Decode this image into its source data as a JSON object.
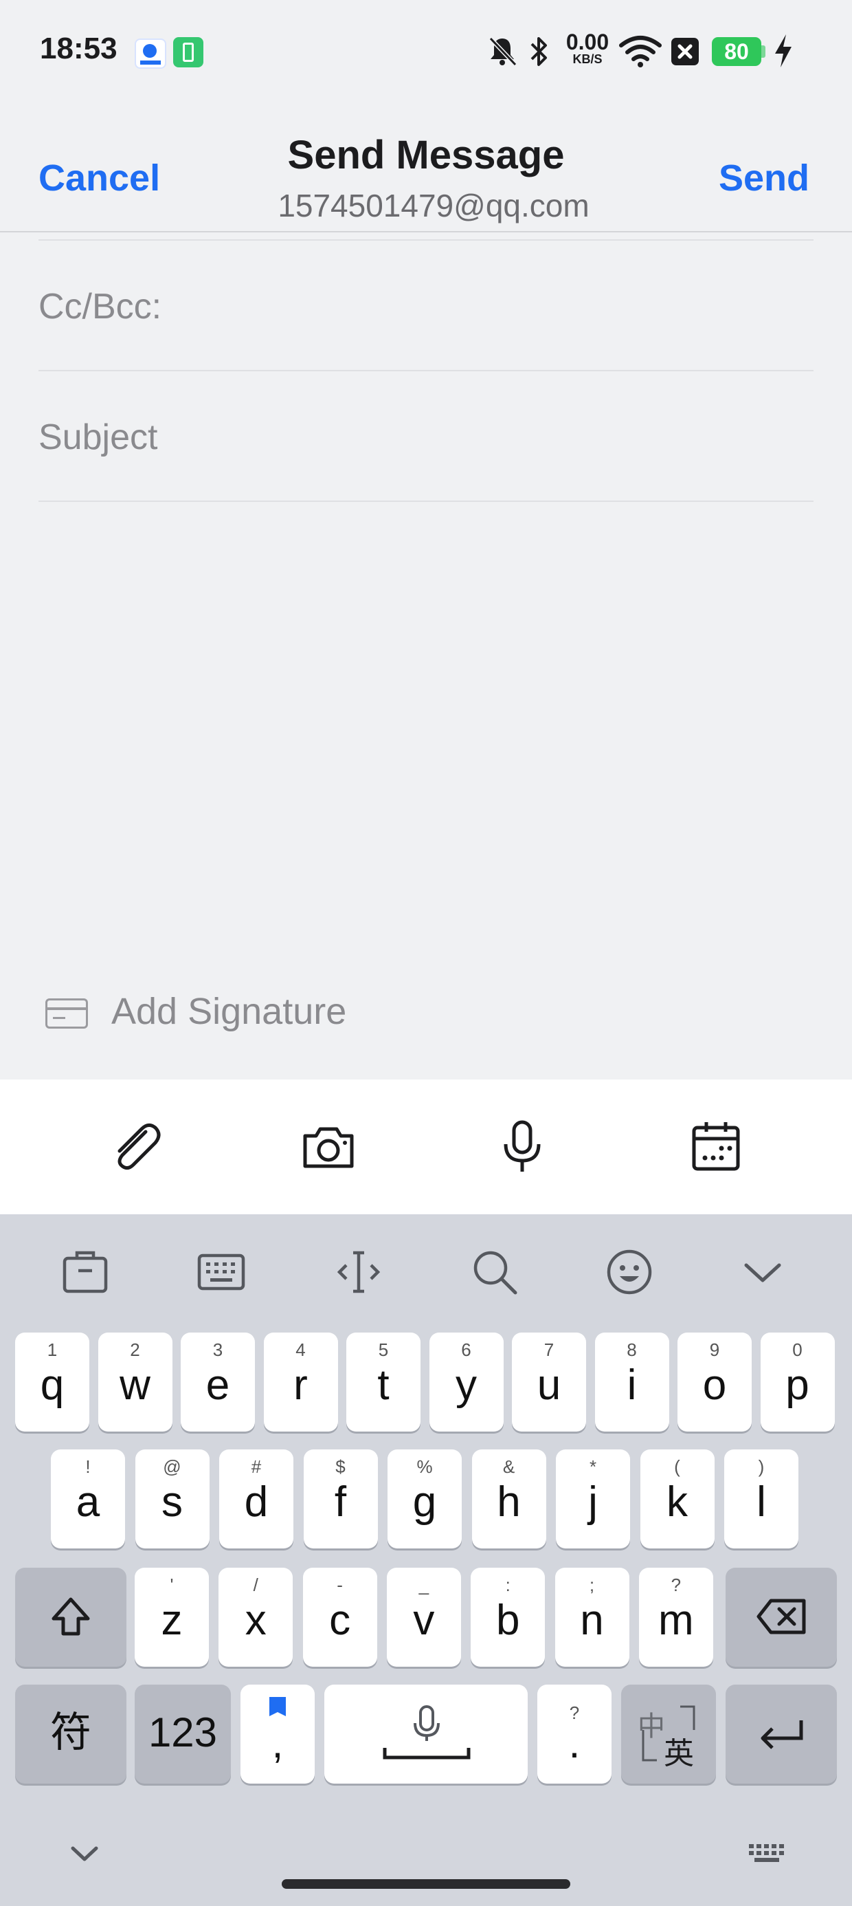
{
  "status_bar": {
    "time": "18:53",
    "net_speed_value": "0.00",
    "net_speed_unit": "KB/S",
    "battery_level": "80",
    "icons": [
      "app-badge-icon",
      "battery-saver-icon",
      "mute-icon",
      "bluetooth-icon",
      "wifi-icon",
      "close-box-icon",
      "battery-icon",
      "charging-icon"
    ]
  },
  "header": {
    "cancel_label": "Cancel",
    "title": "Send Message",
    "subtitle": "1574501479@qq.com",
    "send_label": "Send"
  },
  "form": {
    "cc_bcc_label": "Cc/Bcc:",
    "subject_placeholder": "Subject",
    "signature_label": "Add Signature"
  },
  "toolbar": {
    "icons": [
      "paperclip-icon",
      "camera-icon",
      "microphone-icon",
      "calendar-icon"
    ]
  },
  "keyboard": {
    "tools": [
      "clipboard-icon",
      "keyboard-layout-icon",
      "cursor-icon",
      "search-icon",
      "emoji-icon",
      "chevron-down-icon"
    ],
    "row1": [
      {
        "main": "q",
        "sub": "1"
      },
      {
        "main": "w",
        "sub": "2"
      },
      {
        "main": "e",
        "sub": "3"
      },
      {
        "main": "r",
        "sub": "4"
      },
      {
        "main": "t",
        "sub": "5"
      },
      {
        "main": "y",
        "sub": "6"
      },
      {
        "main": "u",
        "sub": "7"
      },
      {
        "main": "i",
        "sub": "8"
      },
      {
        "main": "o",
        "sub": "9"
      },
      {
        "main": "p",
        "sub": "0"
      }
    ],
    "row2": [
      {
        "main": "a",
        "sub": "!"
      },
      {
        "main": "s",
        "sub": "@"
      },
      {
        "main": "d",
        "sub": "#"
      },
      {
        "main": "f",
        "sub": "$"
      },
      {
        "main": "g",
        "sub": "%"
      },
      {
        "main": "h",
        "sub": "&"
      },
      {
        "main": "j",
        "sub": "*"
      },
      {
        "main": "k",
        "sub": "("
      },
      {
        "main": "l",
        "sub": ")"
      }
    ],
    "row3": [
      {
        "main": "z",
        "sub": "'"
      },
      {
        "main": "x",
        "sub": "/"
      },
      {
        "main": "c",
        "sub": "-"
      },
      {
        "main": "v",
        "sub": "_"
      },
      {
        "main": "b",
        "sub": ":"
      },
      {
        "main": "n",
        "sub": ";"
      },
      {
        "main": "m",
        "sub": "?"
      }
    ],
    "symbols_label": "符",
    "numbers_label": "123",
    "comma_label": ",",
    "period_label": ".",
    "period_sub": "?",
    "lang_top": "中",
    "lang_bottom": "英"
  },
  "colors": {
    "accent": "#1f6df2",
    "battery": "#2fc75a",
    "keyboard_bg": "#d3d6dd"
  }
}
